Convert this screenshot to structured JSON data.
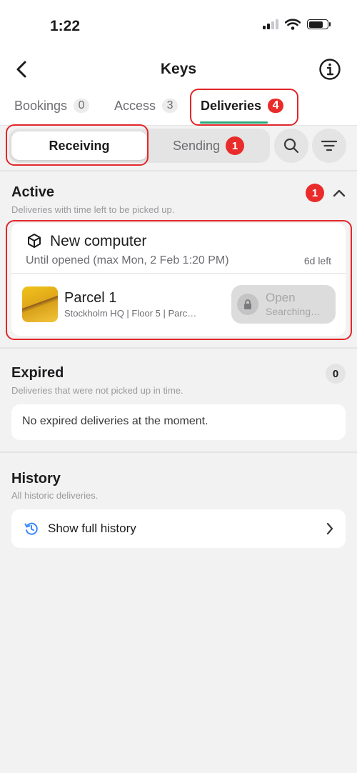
{
  "status": {
    "time": "1:22"
  },
  "header": {
    "title": "Keys"
  },
  "tabs": [
    {
      "label": "Bookings",
      "count": "0"
    },
    {
      "label": "Access",
      "count": "3"
    },
    {
      "label": "Deliveries",
      "count": "4"
    }
  ],
  "segment": {
    "receiving": "Receiving",
    "sending": "Sending",
    "sending_badge": "1"
  },
  "active": {
    "title": "Active",
    "subtitle": "Deliveries with time left to be picked up.",
    "badge": "1",
    "delivery": {
      "name": "New computer",
      "until": "Until opened (max Mon, 2 Feb 1:20 PM)",
      "time_left": "6d left",
      "parcel_name": "Parcel 1",
      "parcel_location": "Stockholm HQ | Floor 5 | Parc…",
      "open_label": "Open",
      "open_status": "Searching…"
    }
  },
  "expired": {
    "title": "Expired",
    "subtitle": "Deliveries that were not picked up in time.",
    "count": "0",
    "empty_text": "No expired deliveries at the moment."
  },
  "history": {
    "title": "History",
    "subtitle": "All historic deliveries.",
    "link_label": "Show full history"
  },
  "colors": {
    "accent_red": "#ea2b2b",
    "accent_green": "#2aa87a",
    "history_icon": "#3a86ff",
    "highlight": "#e3262a"
  },
  "icons": [
    "chevron-left-icon",
    "info-icon",
    "search-icon",
    "filter-icon",
    "package-icon",
    "lock-icon",
    "history-icon",
    "chevron-right-icon"
  ]
}
